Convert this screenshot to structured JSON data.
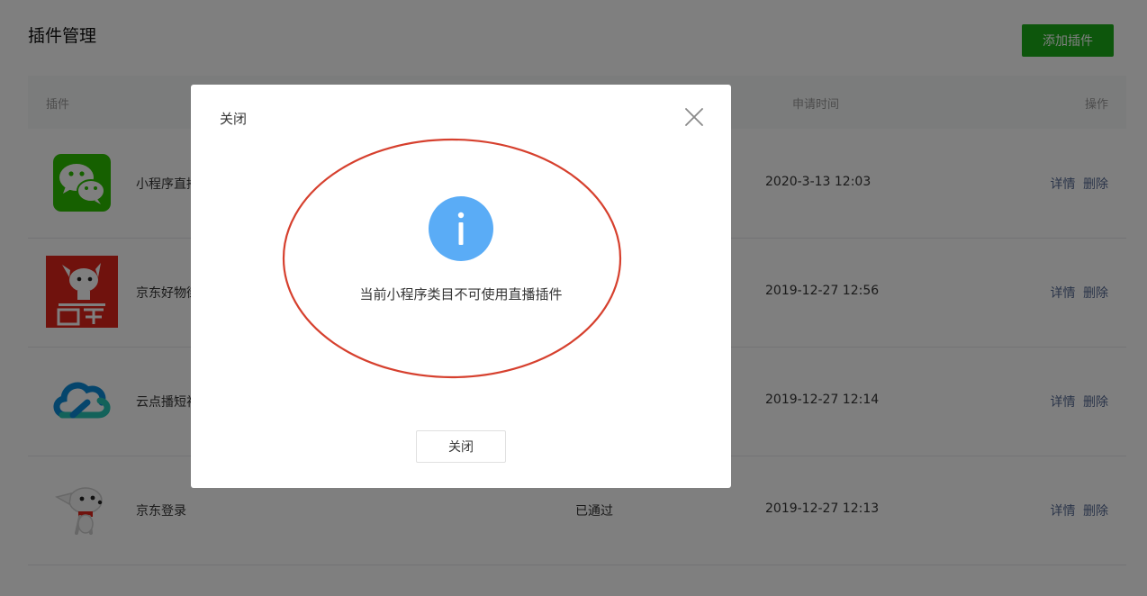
{
  "page": {
    "title": "插件管理",
    "add_button": "添加插件"
  },
  "table": {
    "headers": {
      "plugin": "插件",
      "time": "申请时间",
      "ops": "操作"
    },
    "rows": [
      {
        "name": "小程序直播",
        "status": "",
        "time": "2020-3-13 12:03",
        "detail": "详情",
        "delete": "删除",
        "icon": "wechat-icon"
      },
      {
        "name": "京东好物街",
        "status": "",
        "time": "2019-12-27 12:56",
        "detail": "详情",
        "delete": "删除",
        "icon": "jd-logo-icon"
      },
      {
        "name": "云点播短视频",
        "status": "",
        "time": "2019-12-27 12:14",
        "detail": "详情",
        "delete": "删除",
        "icon": "cloud-icon"
      },
      {
        "name": "京东登录",
        "status": "已通过",
        "time": "2019-12-27 12:13",
        "detail": "详情",
        "delete": "删除",
        "icon": "jd-dog-icon"
      }
    ]
  },
  "dialog": {
    "title": "关闭",
    "message": "当前小程序类目不可使用直播插件",
    "button": "关闭",
    "icon": "info-icon"
  },
  "colors": {
    "brand_green": "#1aad19",
    "link": "#576b95",
    "info_blue": "#5aacf6",
    "annotation_red": "#d6402e"
  }
}
